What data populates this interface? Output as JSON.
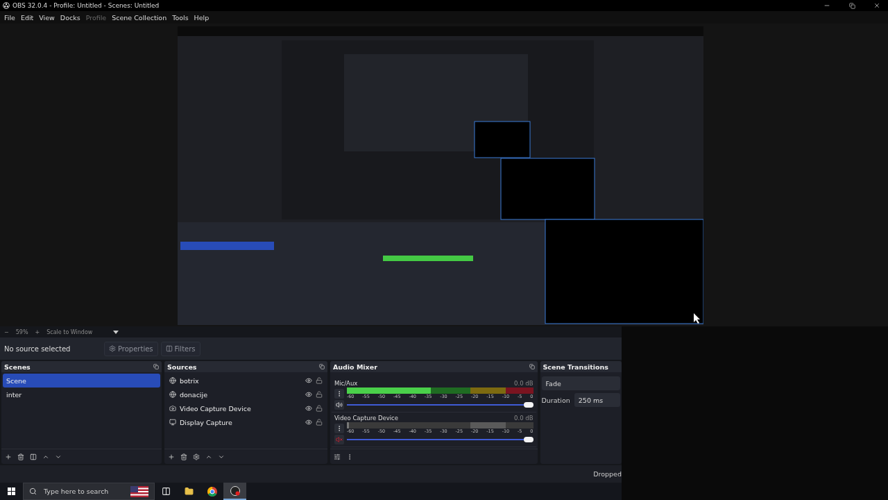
{
  "window": {
    "title": "OBS 32.0.4 - Profile: Untitled - Scenes: Untitled"
  },
  "menu": [
    {
      "label": "File",
      "disabled": false
    },
    {
      "label": "Edit",
      "disabled": false
    },
    {
      "label": "View",
      "disabled": false
    },
    {
      "label": "Docks",
      "disabled": false
    },
    {
      "label": "Profile",
      "disabled": true
    },
    {
      "label": "Scene Collection",
      "disabled": false
    },
    {
      "label": "Tools",
      "disabled": false
    },
    {
      "label": "Help",
      "disabled": false
    }
  ],
  "zoom_bar": {
    "minus": "−",
    "zoom": "59%",
    "plus": "+",
    "scale_mode": "Scale to Window"
  },
  "source_toolbar": {
    "status": "No source selected",
    "buttons": [
      {
        "label": "Properties",
        "kind": "properties"
      },
      {
        "label": "Filters",
        "kind": "filters"
      }
    ]
  },
  "scenes": {
    "title": "Scenes",
    "items": [
      {
        "name": "Scene",
        "selected": true
      },
      {
        "name": "inter",
        "selected": false
      }
    ]
  },
  "sources": {
    "title": "Sources",
    "items": [
      {
        "name": "botrix",
        "kind": "browser",
        "visible": true,
        "locked": false
      },
      {
        "name": "donacije",
        "kind": "browser",
        "visible": true,
        "locked": false
      },
      {
        "name": "Video Capture Device",
        "kind": "camera",
        "visible": true,
        "locked": false
      },
      {
        "name": "Display Capture",
        "kind": "display",
        "visible": true,
        "locked": false
      }
    ]
  },
  "audio_mixer": {
    "title": "Audio Mixer",
    "channels": [
      {
        "name": "Mic/Aux",
        "reading": "0.0 dB",
        "muted": false,
        "meter": {
          "level": 0.45
        },
        "volume": {
          "level": 1
        },
        "scale": [
          "-60",
          "-55",
          "-50",
          "-45",
          "-40",
          "-35",
          "-30",
          "-25",
          "-20",
          "-15",
          "-10",
          "-5",
          "0"
        ]
      },
      {
        "name": "Video Capture Device",
        "reading": "0.0 dB",
        "muted": true,
        "meter": {
          "level": 0.01
        },
        "volume": {
          "level": 1
        },
        "scale": [
          "-60",
          "-55",
          "-50",
          "-45",
          "-40",
          "-35",
          "-30",
          "-25",
          "-20",
          "-15",
          "-10",
          "-5",
          "0"
        ]
      }
    ]
  },
  "scene_transitions": {
    "title": "Scene Transitions",
    "transition": "Fade",
    "duration_label": "Duration",
    "duration": "250 ms"
  },
  "status_bar": {
    "text": "Dropped"
  },
  "taskbar": {
    "search": {
      "placeholder": "Type here to search"
    },
    "apps": [
      {
        "kind": "taskview",
        "active": false
      },
      {
        "kind": "folder",
        "active": false
      },
      {
        "kind": "browser",
        "active": false
      },
      {
        "kind": "obs",
        "active": true
      }
    ]
  }
}
